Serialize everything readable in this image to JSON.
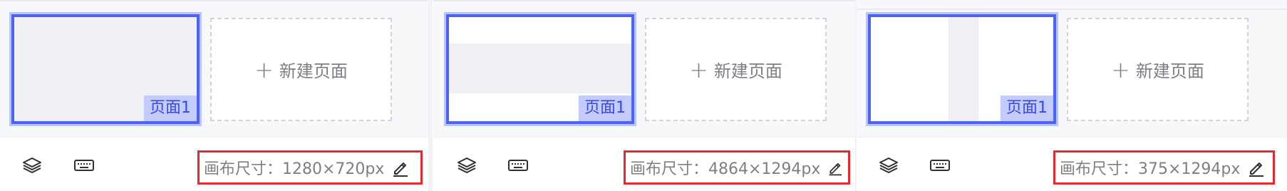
{
  "panels": [
    {
      "page_label": "页面1",
      "new_page_label": "新建页面",
      "canvas_size_label": "画布尺寸：1280×720px"
    },
    {
      "page_label": "页面1",
      "new_page_label": "新建页面",
      "canvas_size_label": "画布尺寸：4864×1294px"
    },
    {
      "page_label": "页面1",
      "new_page_label": "新建页面",
      "canvas_size_label": "画布尺寸：375×1294px"
    }
  ],
  "icons": [
    "layers-icon",
    "keyboard-icon",
    "edit-pencil-icon",
    "plus-icon"
  ],
  "colors": {
    "accent": "#4d63f6",
    "accent_light": "#c3ccfc",
    "highlight_box": "#e32a2f",
    "text_muted": "#7d7f84"
  }
}
